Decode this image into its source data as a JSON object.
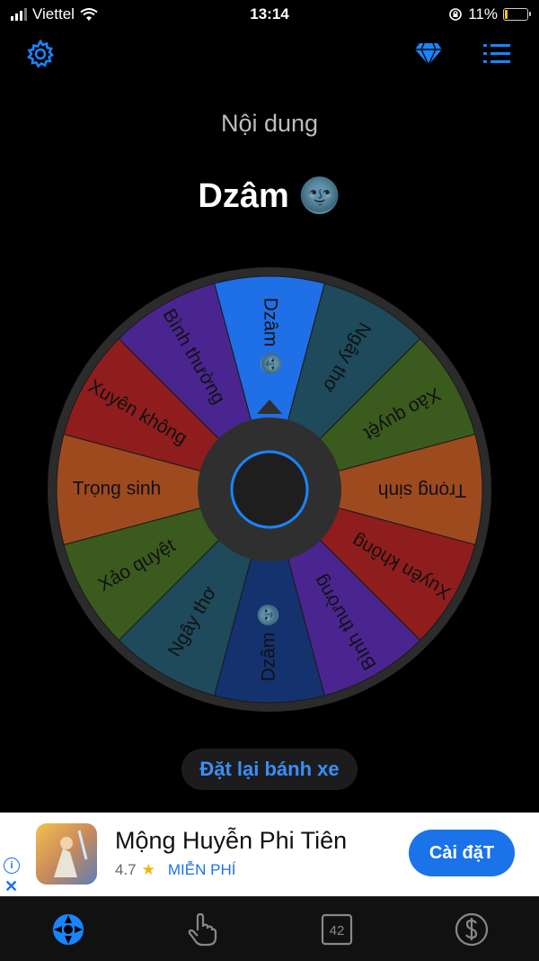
{
  "status": {
    "carrier": "Viettel",
    "time": "13:14",
    "battery": "11%",
    "battery_level": 0.11
  },
  "icons": {
    "settings": "gear-icon",
    "premium": "diamond-icon",
    "list": "list-icon"
  },
  "header": {
    "label": "Nội dung",
    "result": "Dzâm 🌚"
  },
  "wheel": {
    "segments": [
      {
        "label": "Dzâm 🌚",
        "color": "#1f6fe6"
      },
      {
        "label": "Ngây thơ",
        "color": "#1e4a5b"
      },
      {
        "label": "Xảo quyệt",
        "color": "#3b5a1e"
      },
      {
        "label": "Trọng sinh",
        "color": "#9e4a1f"
      },
      {
        "label": "Xuyên không",
        "color": "#8f1d1d"
      },
      {
        "label": "Bình thường",
        "color": "#4a2590"
      },
      {
        "label": "Dzâm 🌚",
        "color": "#13326e"
      },
      {
        "label": "Ngây thơ",
        "color": "#1e4a5b"
      },
      {
        "label": "Xảo quyệt",
        "color": "#3b5a1e"
      },
      {
        "label": "Trọng sinh",
        "color": "#9e4a1f"
      },
      {
        "label": "Xuyên không",
        "color": "#8f1d1d"
      },
      {
        "label": "Bình thường",
        "color": "#4a2590"
      }
    ]
  },
  "reset_button": "Đặt lại bánh xe",
  "ad": {
    "title": "Mộng Huyễn Phi Tiên",
    "rating": "4.7",
    "price": "MIỄN PHÍ",
    "cta": "Cài đặT",
    "info_glyph": "i",
    "close_glyph": "✕"
  },
  "tabs": [
    {
      "name": "wheel-tab",
      "icon": "wheel-icon",
      "active": true
    },
    {
      "name": "tap-tab",
      "icon": "tap-hand-icon",
      "active": false
    },
    {
      "name": "number-tab",
      "icon": "number-icon",
      "label": "42",
      "active": false
    },
    {
      "name": "money-tab",
      "icon": "dollar-icon",
      "active": false
    }
  ],
  "colors": {
    "accent": "#1a84ff",
    "wheel_rim": "#2b2b2b",
    "hub": "#2f2f2f",
    "hub_ring": "#1a84ff"
  }
}
